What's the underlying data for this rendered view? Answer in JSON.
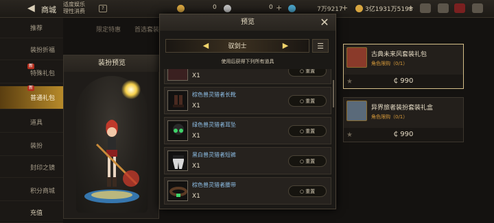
{
  "topbar": {
    "title": "商城",
    "notice_line1": "适度娱乐",
    "notice_line2": "理性消费",
    "notice_icon_label": "?",
    "currency1": "0",
    "currency2": "0",
    "currency3": "7万9217",
    "currency4": "3亿1931万5198",
    "plus": "+"
  },
  "sidebar": {
    "items": [
      {
        "label": "推荐"
      },
      {
        "label": "装扮折福"
      },
      {
        "label": "特殊礼包",
        "tag": "新"
      },
      {
        "label": "普通礼包",
        "tag": "新"
      },
      {
        "label": "道具"
      },
      {
        "label": "装扮"
      },
      {
        "label": "封印之镜"
      },
      {
        "label": "积分商城"
      },
      {
        "label": "充值"
      }
    ]
  },
  "bg_tabs": [
    "限定特惠",
    "首选套装"
  ],
  "preview": {
    "title": "装扮预览"
  },
  "cards": [
    {
      "name": "古典未来风套装礼包",
      "limit": "角色限购（0/1）",
      "price": "990"
    },
    {
      "name": "异界旅者装扮套装礼盒",
      "limit": "角色限购（0/1）",
      "price": "990"
    }
  ],
  "currency_symbol": "₵",
  "modal": {
    "title": "预览",
    "class_name": "驭剑士",
    "subtitle": "使用后获得下列所有道具",
    "reset_label": "重置",
    "items": [
      {
        "name": "",
        "qty": "X1"
      },
      {
        "name": "棕色兽灵猎者长靴",
        "qty": "X1"
      },
      {
        "name": "绿色兽灵猎者耳坠",
        "qty": "X1"
      },
      {
        "name": "黑白兽灵猎者短裤",
        "qty": "X1"
      },
      {
        "name": "棕色兽灵猎者腰带",
        "qty": "X1"
      }
    ]
  },
  "colors": {
    "accent": "#b78a2a",
    "item_name": "#8fc0e8",
    "limit": "#d79a3a"
  }
}
